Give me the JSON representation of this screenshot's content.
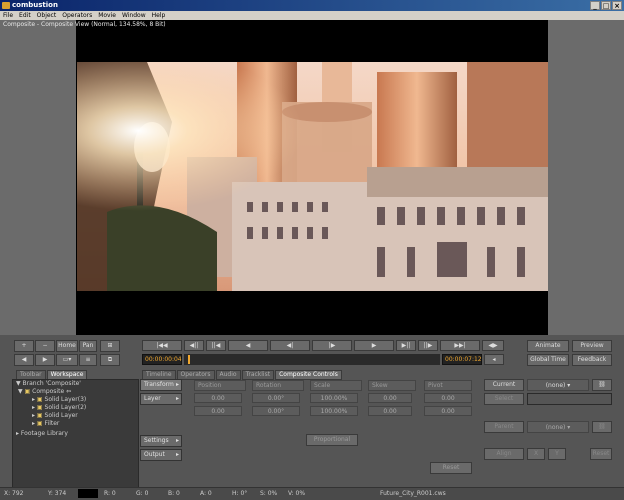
{
  "window": {
    "title": "combustion",
    "min": "_",
    "max": "□",
    "close": "×"
  },
  "menu": [
    "File",
    "Edit",
    "Object",
    "Operators",
    "Movie",
    "Window",
    "Help"
  ],
  "viewer": {
    "label": "Composite - Composite View (Normal, 134.58%, 8 Bit)"
  },
  "left_top_buttons": {
    "plus": "+",
    "minus": "−",
    "home": "Home",
    "pan": "Pan"
  },
  "left_tabs": [
    "Toolbar",
    "Workspace"
  ],
  "tree": [
    {
      "label": "Branch 'Composite'",
      "indent": 0
    },
    {
      "label": "Composite",
      "indent": 1
    },
    {
      "label": "Solid Layer(3)",
      "indent": 2
    },
    {
      "label": "Solid Layer(2)",
      "indent": 2
    },
    {
      "label": "Solid Layer",
      "indent": 2
    },
    {
      "label": "Filter",
      "indent": 2
    },
    {
      "label": "Footage Library",
      "indent": 0
    }
  ],
  "timecode": {
    "current": "00:00:00:04",
    "end": "00:00:07:12"
  },
  "transport": [
    "|◀◀",
    "◀||",
    "||◀",
    "◀",
    "◀|",
    "|▶",
    "▶",
    "▶||",
    "||▶",
    "▶▶|",
    "◀▶"
  ],
  "right_buttons": {
    "animate": "Animate",
    "preview": "Preview",
    "global_time": "Global Time",
    "feedback": "Feedback"
  },
  "controls_tabs": [
    "Timeline",
    "Operators",
    "Audio",
    "Tracklist",
    "Composite Controls"
  ],
  "side_buttons": [
    "Transform",
    "Layer",
    "Settings",
    "Output"
  ],
  "param_headers": [
    "Position",
    "Rotation",
    "Scale",
    "Skew",
    "Pivot"
  ],
  "param_values": {
    "position": [
      "0.00",
      "0.00"
    ],
    "rotation": [
      "0.00°",
      "0.00°"
    ],
    "scale": [
      "100.00%",
      "100.00%"
    ],
    "skew": [
      "0.00",
      "0.00"
    ],
    "pivot": [
      "0.00",
      "0.00"
    ]
  },
  "proportional": "Proportional",
  "reset": "Reset",
  "right_panel": {
    "current": "Current",
    "current_value": "(none)",
    "select": "Select",
    "parent": "Parent",
    "parent_value": "(none)",
    "align": "Align",
    "x": "X",
    "y": "Y",
    "reset": "Reset"
  },
  "status": {
    "x": "X: 792",
    "y": "Y: 374",
    "r": "R: 0",
    "g": "G: 0",
    "b": "B: 0",
    "a": "A: 0",
    "h": "H: 0°",
    "s": "S: 0%",
    "v": "V: 0%",
    "file": "Future_City_R001.cws"
  }
}
